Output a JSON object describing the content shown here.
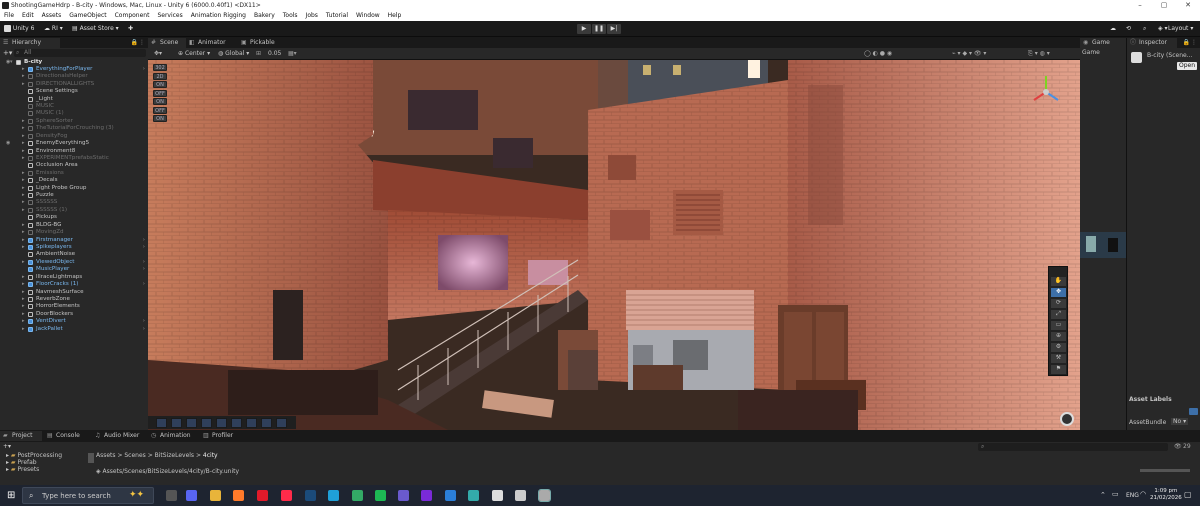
{
  "window": {
    "title": "ShootingGameHdrp - B-city - Windows, Mac, Linux - Unity 6 (6000.0.40f1) <DX11>",
    "controls": [
      "–",
      "▢",
      "✕"
    ]
  },
  "menu": [
    "File",
    "Edit",
    "Assets",
    "GameObject",
    "Component",
    "Services",
    "Animation Rigging",
    "Bakery",
    "Tools",
    "Jobs",
    "Tutorial",
    "Window",
    "Help"
  ],
  "toolbar": {
    "unity_label": "Unity 6",
    "account": "RI",
    "asset_store": "Asset Store",
    "layers": "Layers",
    "layout": "Layout"
  },
  "hierarchy": {
    "tab": "Hierarchy",
    "search_placeholder": "All",
    "root": "B-city",
    "items": [
      {
        "label": "EverythingForPlayer",
        "style": "blue"
      },
      {
        "label": "DirectionalsHelper",
        "style": "dim"
      },
      {
        "label": "DIRECTIONALLIGHTS",
        "style": "dim"
      },
      {
        "label": "Scene Settings",
        "style": "normal"
      },
      {
        "label": "_Light",
        "style": "normal"
      },
      {
        "label": "MUSIC",
        "style": "dim"
      },
      {
        "label": "MUSIC (1)",
        "style": "dim"
      },
      {
        "label": "SphereSorter",
        "style": "dim"
      },
      {
        "label": "TheTutorialForCrouching (3)",
        "style": "dim"
      },
      {
        "label": "DensityFog",
        "style": "dim"
      },
      {
        "label": "EnemyEverything5",
        "style": "normal"
      },
      {
        "label": "Environment8",
        "style": "normal"
      },
      {
        "label": "EXPERIMENTprefabsStatic",
        "style": "dim"
      },
      {
        "label": "Occlusion Area",
        "style": "normal"
      },
      {
        "label": "Emissions",
        "style": "dim"
      },
      {
        "label": "_Decals",
        "style": "normal"
      },
      {
        "label": "Light Probe Group",
        "style": "normal"
      },
      {
        "label": "Puzzle",
        "style": "normal"
      },
      {
        "label": "SSSSSS",
        "style": "dim"
      },
      {
        "label": "SSSSSS (1)",
        "style": "dim"
      },
      {
        "label": "Pickups",
        "style": "normal"
      },
      {
        "label": "BLDG-BG",
        "style": "normal"
      },
      {
        "label": "MovingZd",
        "style": "dim"
      },
      {
        "label": "Firstmanager",
        "style": "blue"
      },
      {
        "label": "Spikeplayers",
        "style": "blue"
      },
      {
        "label": "AmbientNoise",
        "style": "normal"
      },
      {
        "label": "ViewedObject",
        "style": "blue"
      },
      {
        "label": "MusicPlayer",
        "style": "blue"
      },
      {
        "label": "lllraceLightmaps",
        "style": "normal"
      },
      {
        "label": "FloorCracks (1)",
        "style": "blue"
      },
      {
        "label": "NavmeshSurface",
        "style": "normal"
      },
      {
        "label": "ReverbZone",
        "style": "normal"
      },
      {
        "label": "HorrorElements",
        "style": "normal"
      },
      {
        "label": "DoorBlockers",
        "style": "normal"
      },
      {
        "label": "VentDivert",
        "style": "blue"
      },
      {
        "label": "JackPallet",
        "style": "blue"
      }
    ]
  },
  "scene": {
    "tabs": [
      "Scene",
      "Animator",
      "Pickable 1"
    ],
    "pivot": "Center",
    "space": "Global",
    "snap": "0.05",
    "left_tools": [
      "302",
      "2D",
      "ON",
      "OFF",
      "ON",
      "OFF",
      "ON"
    ],
    "persp": "Persp..."
  },
  "game": {
    "tab": "Game",
    "display": "Game"
  },
  "inspector": {
    "tab": "Inspector",
    "object": "B-city (Scene...",
    "open_button": "Open",
    "asset_labels": "Asset Labels",
    "asset_bundle": "AssetBundle",
    "bundle_value": "No"
  },
  "bottom": {
    "tabs": [
      "Project",
      "Console",
      "Audio Mixer",
      "Animation",
      "Profiler"
    ],
    "tree": [
      "PostProcessing",
      "Prefab",
      "Presets"
    ],
    "breadcrumb": [
      "Assets",
      "Scenes",
      "BitSizeLevels",
      "4city"
    ],
    "path": "Assets/Scenes/BitSizeLevels/4city/B-city.unity",
    "count": "29"
  },
  "taskbar": {
    "search_placeholder": "Type here to search",
    "lang": "ENG",
    "time": "1:09 pm",
    "date": "21/02/2026"
  },
  "colors": {
    "accent": "#4a90d9",
    "panel": "#282828",
    "bg": "#191919"
  }
}
